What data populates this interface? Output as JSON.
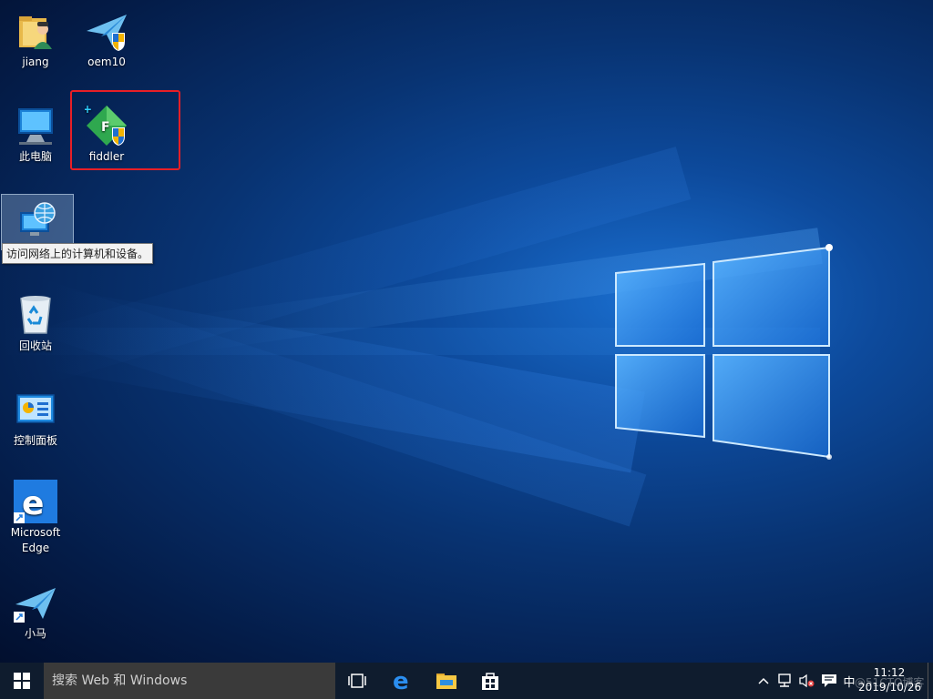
{
  "desktop": {
    "icons": [
      {
        "label": "jiang",
        "icon": "user-folder-icon"
      },
      {
        "label": "oem10",
        "icon": "paper-plane-shield-icon"
      },
      {
        "label": "此电脑",
        "icon": "computer-icon"
      },
      {
        "label": "fiddler",
        "icon": "fiddler-icon"
      },
      {
        "label": "",
        "icon": "network-icon"
      },
      {
        "label": "回收站",
        "icon": "recycle-bin-icon"
      },
      {
        "label": "控制面板",
        "icon": "control-panel-icon"
      },
      {
        "label": "Microsoft Edge",
        "icon": "edge-icon"
      },
      {
        "label": "小马",
        "icon": "paper-plane-shortcut-icon"
      }
    ],
    "tooltip": "访问网络上的计算机和设备。"
  },
  "taskbar": {
    "search_placeholder": "搜索 Web 和 Windows",
    "ime_label": "中",
    "clock_time": "11:12",
    "clock_date": "2019/10/26",
    "watermark": "@51CTO博客"
  },
  "colors": {
    "highlight_box": "#e81f26",
    "taskbar_bg": "#0f1c2e",
    "search_bg": "#3a3a3a"
  }
}
